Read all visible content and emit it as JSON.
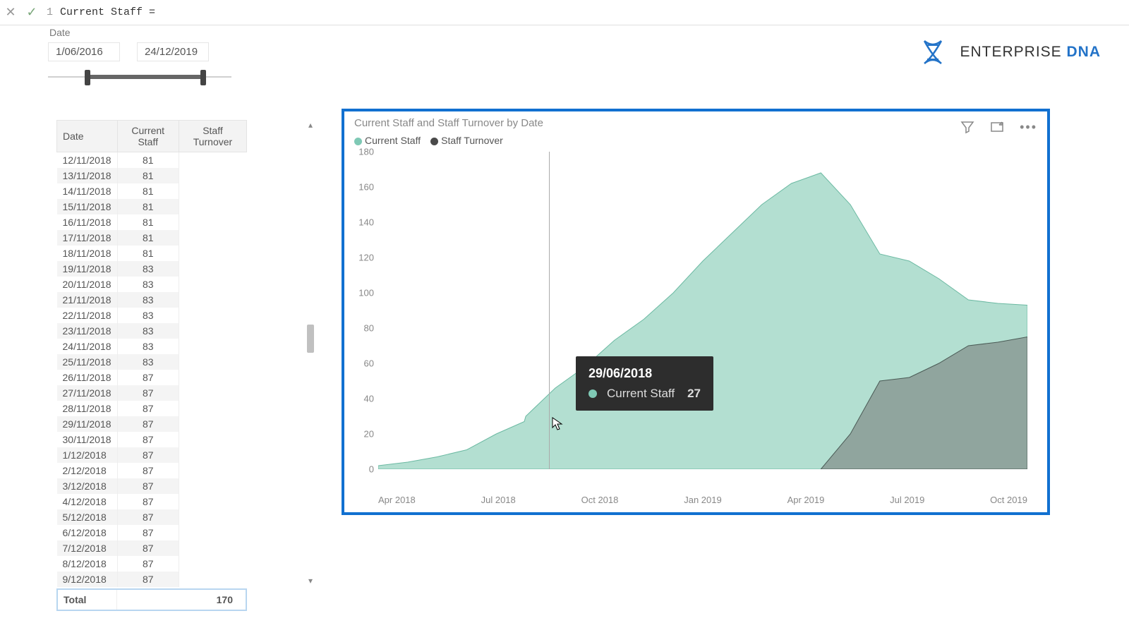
{
  "formula_bar": {
    "line_no": "1",
    "code": "Current Staff ="
  },
  "slicer": {
    "title": "Date",
    "start": "1/06/2016",
    "end": "24/12/2019"
  },
  "logo": {
    "text_a": "ENTERPRISE ",
    "text_b": "DNA"
  },
  "table": {
    "headers": [
      "Date",
      "Current Staff",
      "Staff Turnover"
    ],
    "rows": [
      {
        "d": "12/11/2018",
        "c": "81"
      },
      {
        "d": "13/11/2018",
        "c": "81"
      },
      {
        "d": "14/11/2018",
        "c": "81"
      },
      {
        "d": "15/11/2018",
        "c": "81"
      },
      {
        "d": "16/11/2018",
        "c": "81"
      },
      {
        "d": "17/11/2018",
        "c": "81"
      },
      {
        "d": "18/11/2018",
        "c": "81"
      },
      {
        "d": "19/11/2018",
        "c": "83"
      },
      {
        "d": "20/11/2018",
        "c": "83"
      },
      {
        "d": "21/11/2018",
        "c": "83"
      },
      {
        "d": "22/11/2018",
        "c": "83"
      },
      {
        "d": "23/11/2018",
        "c": "83"
      },
      {
        "d": "24/11/2018",
        "c": "83"
      },
      {
        "d": "25/11/2018",
        "c": "83"
      },
      {
        "d": "26/11/2018",
        "c": "87"
      },
      {
        "d": "27/11/2018",
        "c": "87"
      },
      {
        "d": "28/11/2018",
        "c": "87"
      },
      {
        "d": "29/11/2018",
        "c": "87"
      },
      {
        "d": "30/11/2018",
        "c": "87"
      },
      {
        "d": "1/12/2018",
        "c": "87"
      },
      {
        "d": "2/12/2018",
        "c": "87"
      },
      {
        "d": "3/12/2018",
        "c": "87"
      },
      {
        "d": "4/12/2018",
        "c": "87"
      },
      {
        "d": "5/12/2018",
        "c": "87"
      },
      {
        "d": "6/12/2018",
        "c": "87"
      },
      {
        "d": "7/12/2018",
        "c": "87"
      },
      {
        "d": "8/12/2018",
        "c": "87"
      },
      {
        "d": "9/12/2018",
        "c": "87"
      }
    ],
    "total_label": "Total",
    "total_value": "170"
  },
  "chart": {
    "title": "Current Staff and Staff Turnover by Date",
    "legend": [
      {
        "name": "Current Staff",
        "color": "#7fc9b5"
      },
      {
        "name": "Staff Turnover",
        "color": "#4a4a4a"
      }
    ],
    "y_ticks": [
      "180",
      "160",
      "140",
      "120",
      "100",
      "80",
      "60",
      "40",
      "20",
      "0"
    ],
    "x_ticks": [
      "Apr 2018",
      "Jul 2018",
      "Oct 2018",
      "Jan 2019",
      "Apr 2019",
      "Jul 2019",
      "Oct 2019"
    ],
    "tooltip": {
      "date": "29/06/2018",
      "label": "Current Staff",
      "value": "27",
      "color": "#7fc9b5"
    }
  },
  "chart_data": {
    "type": "area",
    "title": "Current Staff and Staff Turnover by Date",
    "xlabel": "",
    "ylabel": "",
    "ylim": [
      0,
      180
    ],
    "x_range": [
      "Feb 2018",
      "Dec 2019"
    ],
    "series": [
      {
        "name": "Current Staff",
        "color": "#7fc9b5",
        "points": [
          {
            "x": "Feb 2018",
            "y": 2
          },
          {
            "x": "Mar 2018",
            "y": 4
          },
          {
            "x": "Apr 2018",
            "y": 7
          },
          {
            "x": "May 2018",
            "y": 11
          },
          {
            "x": "Jun 2018",
            "y": 20
          },
          {
            "x": "29/06/2018",
            "y": 27
          },
          {
            "x": "Jul 2018",
            "y": 30
          },
          {
            "x": "Aug 2018",
            "y": 46
          },
          {
            "x": "Sep 2018",
            "y": 58
          },
          {
            "x": "Oct 2018",
            "y": 73
          },
          {
            "x": "Nov 2018",
            "y": 85
          },
          {
            "x": "Dec 2018",
            "y": 100
          },
          {
            "x": "Jan 2019",
            "y": 118
          },
          {
            "x": "Feb 2019",
            "y": 134
          },
          {
            "x": "Mar 2019",
            "y": 150
          },
          {
            "x": "Apr 2019",
            "y": 162
          },
          {
            "x": "May 2019",
            "y": 168
          },
          {
            "x": "Jun 2019",
            "y": 150
          },
          {
            "x": "Jul 2019",
            "y": 122
          },
          {
            "x": "Aug 2019",
            "y": 118
          },
          {
            "x": "Sep 2019",
            "y": 108
          },
          {
            "x": "Oct 2019",
            "y": 96
          },
          {
            "x": "Nov 2019",
            "y": 94
          },
          {
            "x": "Dec 2019",
            "y": 93
          }
        ]
      },
      {
        "name": "Staff Turnover",
        "color": "#6b7b76",
        "points": [
          {
            "x": "May 2019",
            "y": 0
          },
          {
            "x": "Jun 2019",
            "y": 20
          },
          {
            "x": "Jul 2019",
            "y": 50
          },
          {
            "x": "Aug 2019",
            "y": 52
          },
          {
            "x": "Sep 2019",
            "y": 60
          },
          {
            "x": "Oct 2019",
            "y": 70
          },
          {
            "x": "Nov 2019",
            "y": 72
          },
          {
            "x": "Dec 2019",
            "y": 75
          }
        ]
      }
    ]
  }
}
